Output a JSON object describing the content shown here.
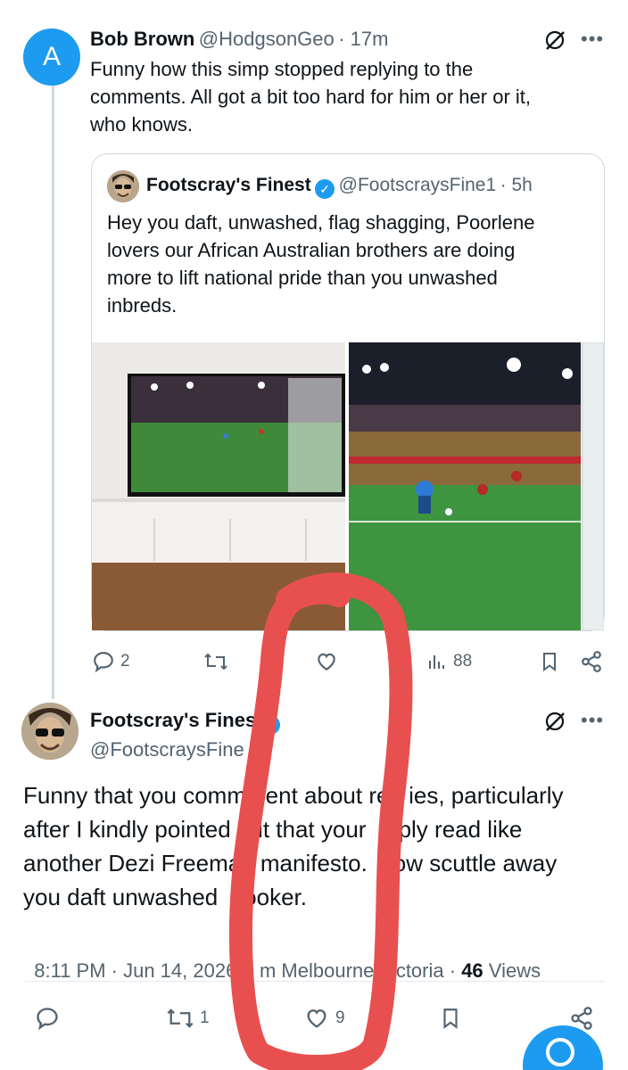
{
  "reply": {
    "avatar_letter": "A",
    "name": "Bob Brown",
    "handle": "@HodgsonGeo",
    "time": "· 17m",
    "text_lines": [
      "Funny how this simp stopped replying to the",
      "comments.  All got a bit too hard for him or her or it,",
      "who knows."
    ]
  },
  "quote": {
    "name": "Footscray's Finest",
    "handle": "@FootscraysFine1",
    "time": "· 5h",
    "text_lines": [
      "Hey you daft, unwashed, flag shagging, Poorlene",
      "lovers our African Australian brothers are doing",
      "more to lift national pride than you unwashed",
      "inbreds."
    ]
  },
  "reply_actions": {
    "replies": "2",
    "views": "88"
  },
  "main": {
    "name": "Footscray's Fines",
    "handle": "@FootscraysFine",
    "text_lines": [
      "Funny that you comm   ent about re   ies, particularly",
      "after I kindly pointed   ut that your   eply read like",
      "another Dezi Freema   manifesto.    ow scuttle away",
      "you daft unwashed    ooker."
    ],
    "meta_prefix": "8:11 PM · Jun 14, 2026 ·",
    "meta_location": "  m Melbourne,   ctoria ·",
    "views_count": "46",
    "views_label": "Views"
  },
  "main_actions": {
    "retweets": "1",
    "likes": "9"
  },
  "colors": {
    "accent": "#1d9bf0",
    "annotation": "#e8504f"
  }
}
